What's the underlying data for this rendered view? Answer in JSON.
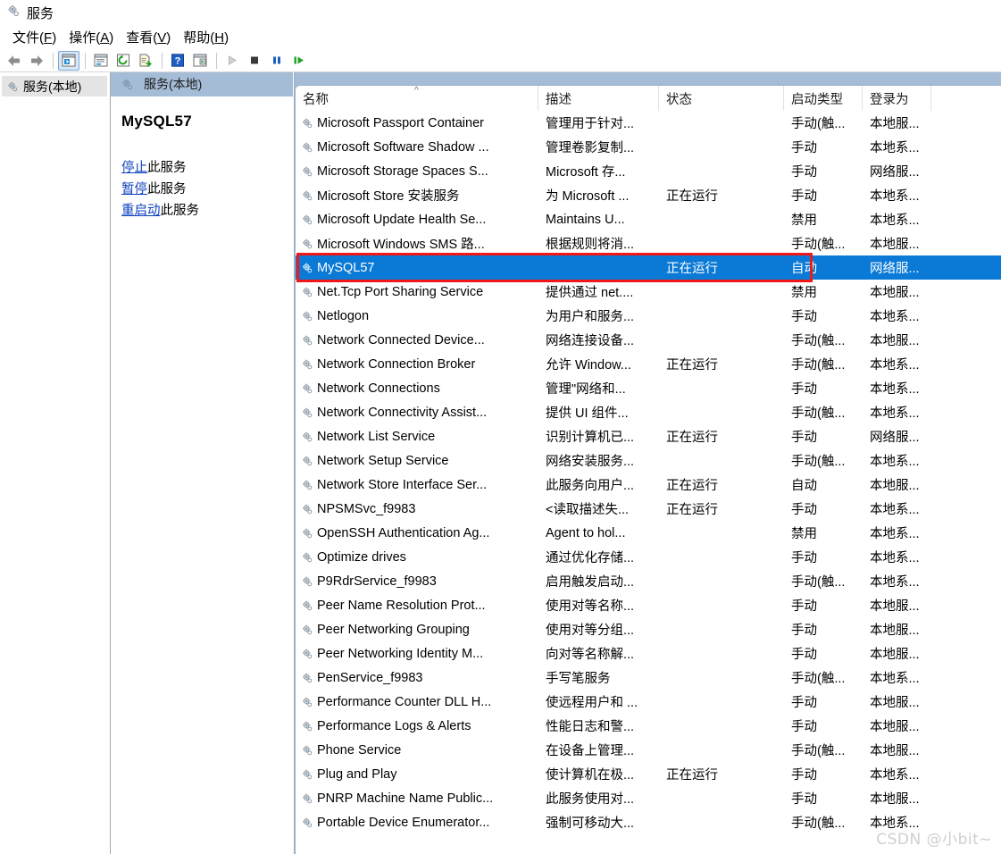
{
  "window": {
    "title": "服务",
    "icon": "services-gear-icon"
  },
  "menubar": [
    {
      "label": "文件",
      "accel": "F"
    },
    {
      "label": "操作",
      "accel": "A"
    },
    {
      "label": "查看",
      "accel": "V"
    },
    {
      "label": "帮助",
      "accel": "H"
    }
  ],
  "toolbar": {
    "buttons": [
      {
        "name": "back-icon",
        "glyph": "back"
      },
      {
        "name": "forward-icon",
        "glyph": "forward"
      },
      {
        "name": "show-hide-tree-icon",
        "glyph": "tree",
        "active": true
      },
      {
        "name": "properties-icon",
        "glyph": "props"
      },
      {
        "name": "refresh-icon",
        "glyph": "refresh"
      },
      {
        "name": "export-list-icon",
        "glyph": "export"
      },
      {
        "name": "help-icon",
        "glyph": "help"
      },
      {
        "name": "show-action-pane-icon",
        "glyph": "pane"
      },
      {
        "name": "start-service-icon",
        "glyph": "start"
      },
      {
        "name": "stop-service-icon",
        "glyph": "stop"
      },
      {
        "name": "pause-service-icon",
        "glyph": "pause"
      },
      {
        "name": "restart-service-icon",
        "glyph": "restart"
      }
    ]
  },
  "tree": {
    "root_label": "服务(本地)"
  },
  "detail": {
    "header_label": "服务(本地)",
    "service_name": "MySQL57",
    "links": [
      {
        "link_text": "停止",
        "suffix": "此服务"
      },
      {
        "link_text": "暂停",
        "suffix": "此服务"
      },
      {
        "link_text": "重启动",
        "suffix": "此服务"
      }
    ]
  },
  "list": {
    "columns": [
      {
        "key": "name",
        "label": "名称",
        "sorted": true,
        "sort_glyph": "^"
      },
      {
        "key": "desc",
        "label": "描述"
      },
      {
        "key": "state",
        "label": "状态"
      },
      {
        "key": "start",
        "label": "启动类型"
      },
      {
        "key": "logon",
        "label": "登录为"
      }
    ],
    "rows": [
      {
        "name": "Microsoft Passport Container",
        "desc": "管理用于针对...",
        "state": "",
        "start": "手动(触...",
        "logon": "本地服..."
      },
      {
        "name": "Microsoft Software Shadow ...",
        "desc": "管理卷影复制...",
        "state": "",
        "start": "手动",
        "logon": "本地系..."
      },
      {
        "name": "Microsoft Storage Spaces S...",
        "desc": "Microsoft 存...",
        "state": "",
        "start": "手动",
        "logon": "网络服..."
      },
      {
        "name": "Microsoft Store 安装服务",
        "desc": "为 Microsoft ...",
        "state": "正在运行",
        "start": "手动",
        "logon": "本地系..."
      },
      {
        "name": "Microsoft Update Health Se...",
        "desc": "Maintains U...",
        "state": "",
        "start": "禁用",
        "logon": "本地系..."
      },
      {
        "name": "Microsoft Windows SMS 路...",
        "desc": "根据规则将消...",
        "state": "",
        "start": "手动(触...",
        "logon": "本地服..."
      },
      {
        "name": "MySQL57",
        "desc": "",
        "state": "正在运行",
        "start": "自动",
        "logon": "网络服...",
        "selected": true
      },
      {
        "name": "Net.Tcp Port Sharing Service",
        "desc": "提供通过 net....",
        "state": "",
        "start": "禁用",
        "logon": "本地服..."
      },
      {
        "name": "Netlogon",
        "desc": "为用户和服务...",
        "state": "",
        "start": "手动",
        "logon": "本地系..."
      },
      {
        "name": "Network Connected Device...",
        "desc": "网络连接设备...",
        "state": "",
        "start": "手动(触...",
        "logon": "本地服..."
      },
      {
        "name": "Network Connection Broker",
        "desc": "允许 Window...",
        "state": "正在运行",
        "start": "手动(触...",
        "logon": "本地系..."
      },
      {
        "name": "Network Connections",
        "desc": "管理\"网络和...",
        "state": "",
        "start": "手动",
        "logon": "本地系..."
      },
      {
        "name": "Network Connectivity Assist...",
        "desc": "提供 UI 组件...",
        "state": "",
        "start": "手动(触...",
        "logon": "本地系..."
      },
      {
        "name": "Network List Service",
        "desc": "识别计算机已...",
        "state": "正在运行",
        "start": "手动",
        "logon": "网络服..."
      },
      {
        "name": "Network Setup Service",
        "desc": "网络安装服务...",
        "state": "",
        "start": "手动(触...",
        "logon": "本地系..."
      },
      {
        "name": "Network Store Interface Ser...",
        "desc": "此服务向用户...",
        "state": "正在运行",
        "start": "自动",
        "logon": "本地服..."
      },
      {
        "name": "NPSMSvc_f9983",
        "desc": "<读取描述失...",
        "state": "正在运行",
        "start": "手动",
        "logon": "本地系..."
      },
      {
        "name": "OpenSSH Authentication Ag...",
        "desc": "Agent to hol...",
        "state": "",
        "start": "禁用",
        "logon": "本地系..."
      },
      {
        "name": "Optimize drives",
        "desc": "通过优化存储...",
        "state": "",
        "start": "手动",
        "logon": "本地系..."
      },
      {
        "name": "P9RdrService_f9983",
        "desc": "启用触发启动...",
        "state": "",
        "start": "手动(触...",
        "logon": "本地系..."
      },
      {
        "name": "Peer Name Resolution Prot...",
        "desc": "使用对等名称...",
        "state": "",
        "start": "手动",
        "logon": "本地服..."
      },
      {
        "name": "Peer Networking Grouping",
        "desc": "使用对等分组...",
        "state": "",
        "start": "手动",
        "logon": "本地服..."
      },
      {
        "name": "Peer Networking Identity M...",
        "desc": "向对等名称解...",
        "state": "",
        "start": "手动",
        "logon": "本地服..."
      },
      {
        "name": "PenService_f9983",
        "desc": "手写笔服务",
        "state": "",
        "start": "手动(触...",
        "logon": "本地系..."
      },
      {
        "name": "Performance Counter DLL H...",
        "desc": "使远程用户和 ...",
        "state": "",
        "start": "手动",
        "logon": "本地服..."
      },
      {
        "name": "Performance Logs & Alerts",
        "desc": "性能日志和警...",
        "state": "",
        "start": "手动",
        "logon": "本地服..."
      },
      {
        "name": "Phone Service",
        "desc": "在设备上管理...",
        "state": "",
        "start": "手动(触...",
        "logon": "本地服..."
      },
      {
        "name": "Plug and Play",
        "desc": "使计算机在极...",
        "state": "正在运行",
        "start": "手动",
        "logon": "本地系..."
      },
      {
        "name": "PNRP Machine Name Public...",
        "desc": "此服务使用对...",
        "state": "",
        "start": "手动",
        "logon": "本地服..."
      },
      {
        "name": "Portable Device Enumerator...",
        "desc": "强制可移动大...",
        "state": "",
        "start": "手动(触...",
        "logon": "本地系..."
      }
    ]
  },
  "annotation": {
    "color": "#f01818",
    "target_row_name": "MySQL57"
  },
  "watermark": {
    "text": "CSDN @小bit~"
  },
  "colors": {
    "selection_blue": "#0a7ad6",
    "header_band": "#a5bcd6",
    "link_blue": "#0b3fbd",
    "annotation_red": "#f01818"
  }
}
